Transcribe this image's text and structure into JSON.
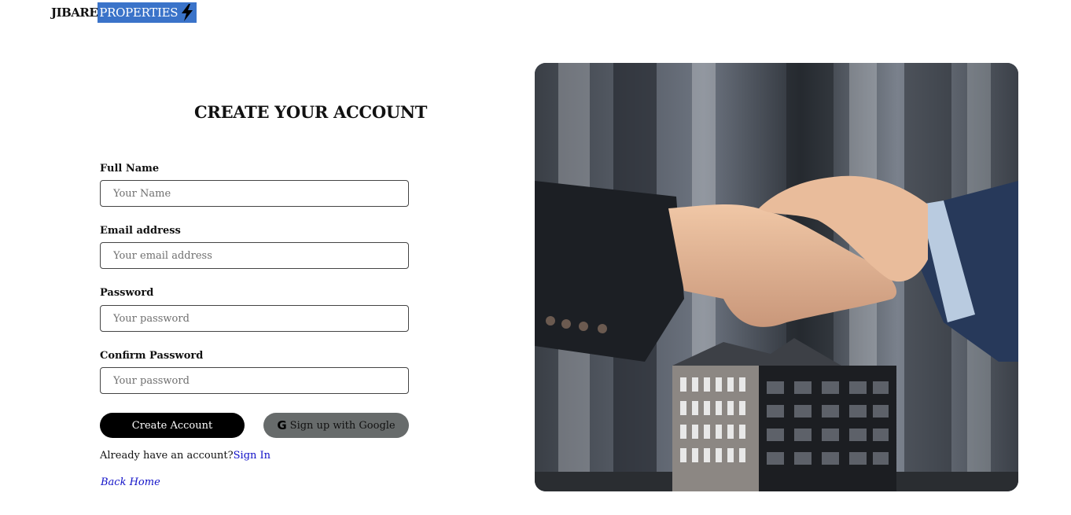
{
  "brand": {
    "name_part1": "JIBARE",
    "name_part2": "PROPERTIES",
    "icon": "lightning-bolt-icon",
    "accent_color": "#3a73c9"
  },
  "form": {
    "title": "CREATE YOUR ACCOUNT",
    "fields": [
      {
        "label": "Full Name",
        "placeholder": "Your Name",
        "value": ""
      },
      {
        "label": "Email address",
        "placeholder": "Your email address",
        "value": ""
      },
      {
        "label": "Password",
        "placeholder": "Your password",
        "value": ""
      },
      {
        "label": "Confirm Password",
        "placeholder": "Your password",
        "value": ""
      }
    ],
    "create_button": "Create Account",
    "google_button": "Sign up with Google",
    "google_icon": "google-g-icon",
    "already_text": "Already have an account?",
    "sign_in_link": "Sign In",
    "back_home_link": "Back Home"
  },
  "hero": {
    "image": "handshake-over-building-model-photo"
  }
}
